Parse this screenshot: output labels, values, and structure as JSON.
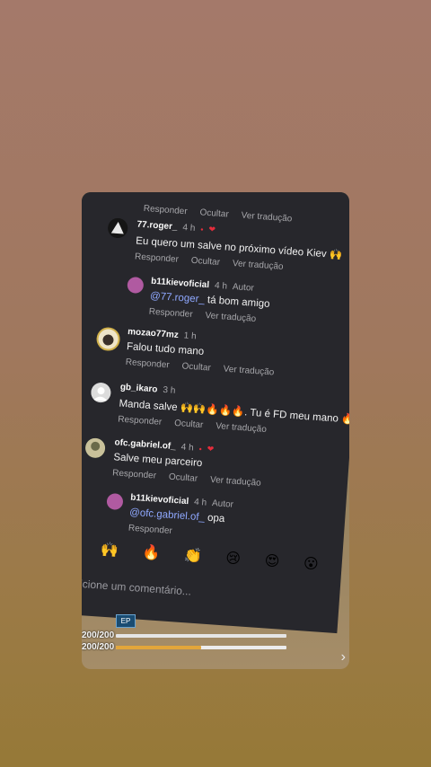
{
  "actions": {
    "reply": "Responder",
    "hide": "Ocultar",
    "translate": "Ver tradução"
  },
  "author_tag": "Autor",
  "comments": [
    {
      "username": "77.roger_",
      "time": "4 h",
      "body": "Eu quero um salve no próximo vídeo Kiev 🙌"
    },
    {
      "username": "b11kievoficial",
      "time": "4 h",
      "mention": "@77.roger_",
      "body": "tá bom amigo"
    },
    {
      "username": "mozao77mz",
      "time": "1 h",
      "body": "Falou tudo mano"
    },
    {
      "username": "gb_ikaro",
      "time": "3 h",
      "body": "Manda salve 🙌🙌🔥🔥🔥. Tu é FD meu mano 🔥🔥"
    },
    {
      "username": "ofc.gabriel.of_",
      "time": "4 h",
      "body": "Salve meu parceiro"
    },
    {
      "username": "b11kievoficial",
      "time": "4 h",
      "mention": "@ofc.gabriel.of_",
      "body": "opa"
    }
  ],
  "emoji_bar": [
    "❤️",
    "🙌",
    "🔥",
    "👏",
    "😢",
    "😍",
    "😮"
  ],
  "composer": {
    "placeholder": "Adicione um comentário..."
  },
  "hud": {
    "ep_label": "EP",
    "hp_text": "200/200",
    "armor_text": "200/200",
    "hp_fraction": 1.0,
    "armor_fraction": 0.5
  },
  "colors": {
    "panel": "#27272c",
    "accent_heart": "#e42d3c",
    "mention": "#8fa8ff"
  }
}
